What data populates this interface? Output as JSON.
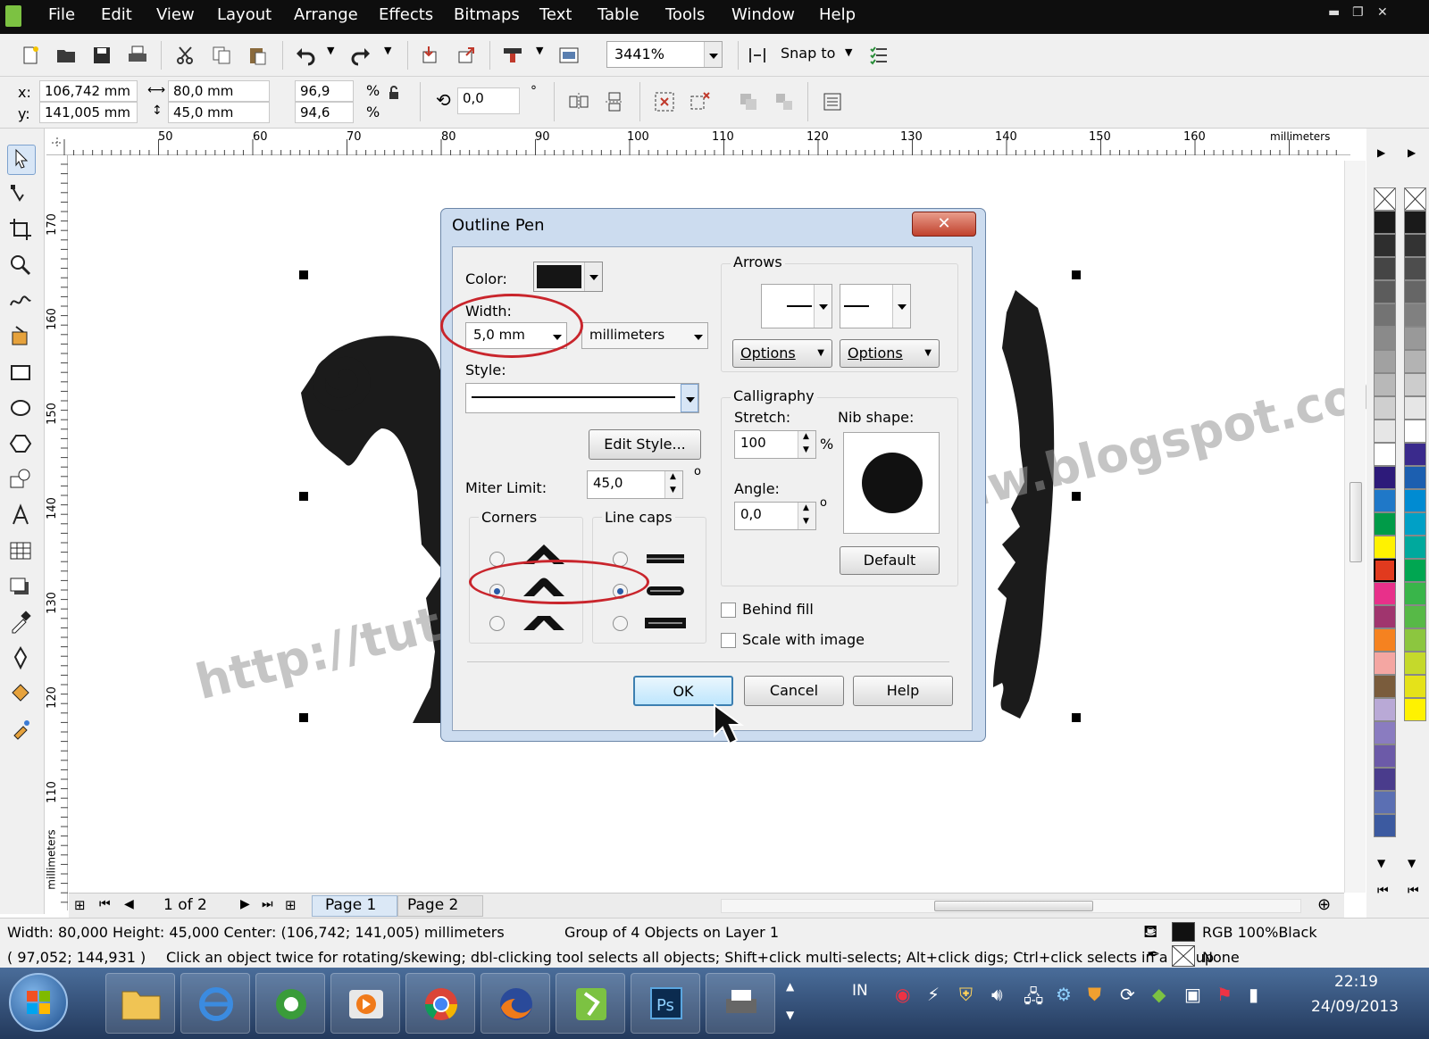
{
  "menu": [
    "File",
    "Edit",
    "View",
    "Layout",
    "Arrange",
    "Effects",
    "Bitmaps",
    "Text",
    "Table",
    "Tools",
    "Window",
    "Help"
  ],
  "toolbar": {
    "zoom": "3441%",
    "snap_to": "Snap to"
  },
  "property_bar": {
    "x_label": "x:",
    "x": "106,742 mm",
    "y_label": "y:",
    "y": "141,005 mm",
    "width": "80,0 mm",
    "height": "45,0 mm",
    "scale_x": "96,9",
    "scale_y": "94,6",
    "percent": "%",
    "rotation": "0,0",
    "degree": "°"
  },
  "ruler_h": {
    "ticks": [
      "50",
      "60",
      "70",
      "80",
      "90",
      "100",
      "110",
      "120",
      "130",
      "140",
      "150",
      "160"
    ],
    "unit": "millimeters"
  },
  "ruler_v": {
    "ticks": [
      "170",
      "160",
      "150",
      "140",
      "130",
      "120",
      "110"
    ],
    "unit": "millimeters"
  },
  "watermark": "http://tutoriallengkapcoreldraw.blogspot.com/",
  "dialog": {
    "title": "Outline Pen",
    "close": "✕",
    "color_label": "Color:",
    "width_label": "Width:",
    "width_value": "5,0 mm",
    "units_value": "millimeters",
    "style_label": "Style:",
    "edit_style": "Edit Style...",
    "miter_label": "Miter Limit:",
    "miter_value": "45,0",
    "miter_unit": "o",
    "corners_label": "Corners",
    "linecaps_label": "Line caps",
    "arrows_label": "Arrows",
    "options_left": "Options",
    "options_right": "Options",
    "calligraphy_label": "Calligraphy",
    "stretch_label": "Stretch:",
    "stretch_value": "100",
    "stretch_unit": "%",
    "nib_label": "Nib shape:",
    "angle_label": "Angle:",
    "angle_value": "0,0",
    "angle_unit": "o",
    "default_btn": "Default",
    "behind_fill": "Behind fill",
    "scale_with_image": "Scale with image",
    "ok": "OK",
    "cancel": "Cancel",
    "help": "Help",
    "corner_selected": 2,
    "linecap_selected": 2
  },
  "page_nav": {
    "counter": "1 of 2",
    "tabs": [
      "Page 1",
      "Page 2"
    ]
  },
  "status": {
    "dimensions": "Width: 80,000  Height: 45,000  Center: (106,742; 141,005)  millimeters",
    "selection": "Group of 4 Objects on Layer 1",
    "fill": "RGB 100%Black",
    "outline": "None",
    "coords": "( 97,052; 144,931 )",
    "hint": "Click an object twice for rotating/skewing; dbl-clicking tool selects all objects; Shift+click multi-selects; Alt+click digs; Ctrl+click selects in a group"
  },
  "taskbar": {
    "lang": "IN",
    "time": "22:19",
    "date": "24/09/2013"
  },
  "palette_colors": [
    "#1a1a1a",
    "#2e2e2e",
    "#454545",
    "#5c5c5c",
    "#737373",
    "#8a8a8a",
    "#a1a1a1",
    "#b8b8b8",
    "#cfcfcf",
    "#e6e6e6",
    "#ffffff",
    "#2d1a7a",
    "#1f78c8",
    "#009b48",
    "#fff200",
    "#e13a1e",
    "#e8308a",
    "#a0356e",
    "#f58220",
    "#f4a6a2",
    "#7a5c3c",
    "#b9a9d6",
    "#8a7cc0",
    "#6c5aa8",
    "#4a3c8c",
    "#5b6fb3",
    "#3c5aa0"
  ],
  "palette2_colors": [
    "#1a1a1a",
    "#333333",
    "#4d4d4d",
    "#666666",
    "#808080",
    "#999999",
    "#b3b3b3",
    "#cccccc",
    "#e6e6e6",
    "#ffffff",
    "#3a2a8c",
    "#1c5fb0",
    "#008bd2",
    "#00a0c6",
    "#00a99d",
    "#00a651",
    "#39b54a",
    "#57b947",
    "#8cc63f",
    "#c5d92b",
    "#e5e219",
    "#fff200"
  ]
}
